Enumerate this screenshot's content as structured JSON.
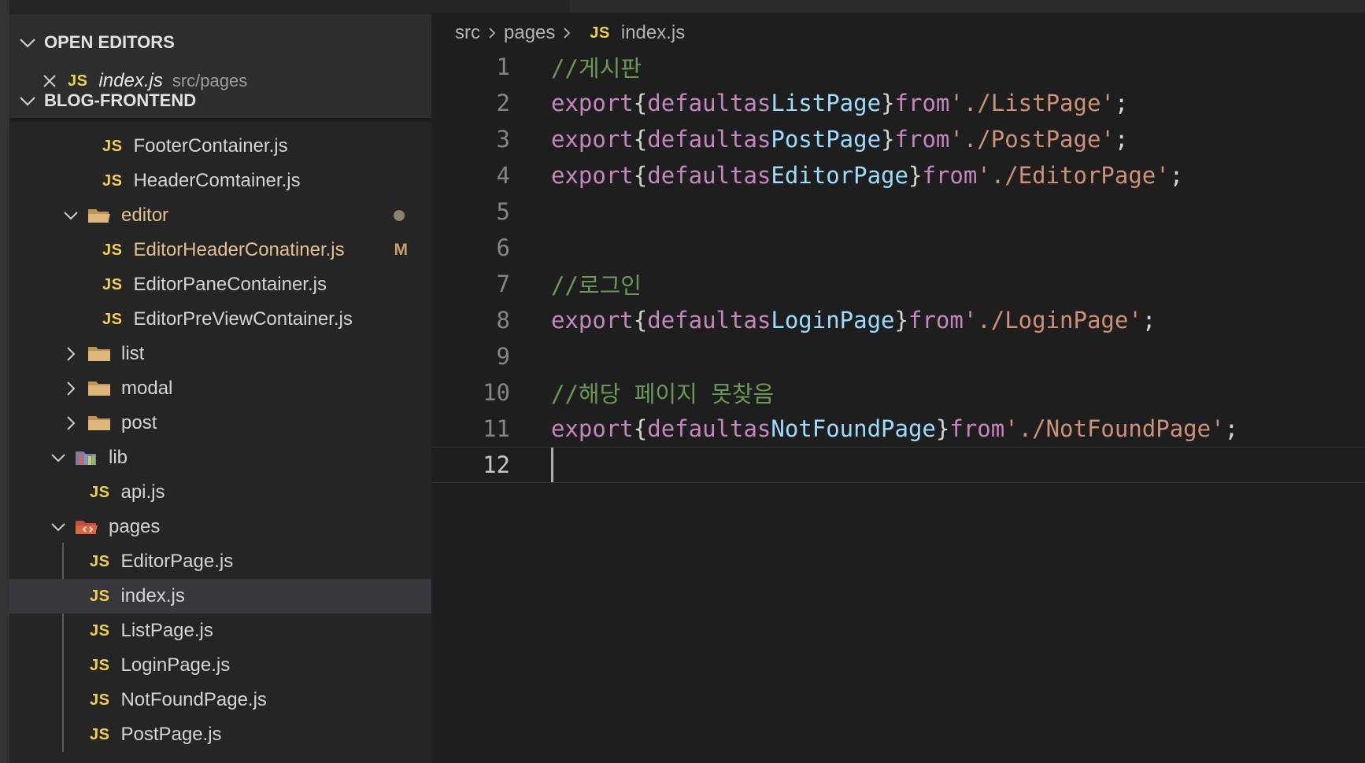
{
  "sidebar": {
    "open_editors": {
      "title": "OPEN EDITORS",
      "item": {
        "badge": "JS",
        "name": "index.js",
        "path": "src/pages"
      }
    },
    "project": {
      "title": "BLOG-FRONTEND"
    },
    "tree": [
      {
        "label": "FooterContainer.js",
        "badge": "JS"
      },
      {
        "label": "HeaderComtainer.js",
        "badge": "JS"
      },
      {
        "label": "editor"
      },
      {
        "label": "EditorHeaderConatiner.js",
        "badge": "JS",
        "status": "M"
      },
      {
        "label": "EditorPaneContainer.js",
        "badge": "JS"
      },
      {
        "label": "EditorPreViewContainer.js",
        "badge": "JS"
      },
      {
        "label": "list"
      },
      {
        "label": "modal"
      },
      {
        "label": "post"
      },
      {
        "label": "lib"
      },
      {
        "label": "api.js",
        "badge": "JS"
      },
      {
        "label": "pages"
      },
      {
        "label": "EditorPage.js",
        "badge": "JS"
      },
      {
        "label": "index.js",
        "badge": "JS"
      },
      {
        "label": "ListPage.js",
        "badge": "JS"
      },
      {
        "label": "LoginPage.js",
        "badge": "JS"
      },
      {
        "label": "NotFoundPage.js",
        "badge": "JS"
      },
      {
        "label": "PostPage.js",
        "badge": "JS"
      }
    ]
  },
  "editor": {
    "breadcrumb": [
      "src",
      "pages",
      "index.js"
    ],
    "breadcrumb_badge": "JS",
    "line_numbers": [
      "1",
      "2",
      "3",
      "4",
      "5",
      "6",
      "7",
      "8",
      "9",
      "10",
      "11",
      "12"
    ],
    "code": {
      "l1_comment": "//게시판",
      "l7_comment": "//로그인",
      "l10_comment": "//해당 페이지 못찾음",
      "kw_export": "export",
      "kw_default": "default",
      "kw_as": "as",
      "kw_from": "from",
      "open_brace": "{",
      "close_brace": "}",
      "semicolon": ";",
      "l2_name": "ListPage",
      "l2_path": "'./ListPage'",
      "l3_name": "PostPage",
      "l3_path": "'./PostPage'",
      "l4_name": "EditorPage",
      "l4_path": "'./EditorPage'",
      "l8_name": "LoginPage",
      "l8_path": "'./LoginPage'",
      "l11_name": "NotFoundPage",
      "l11_path": "'./NotFoundPage'"
    }
  },
  "colors": {
    "comment": "#6a9955",
    "keyword": "#c586c0",
    "identifier": "#9cdcfe",
    "string": "#ce9178",
    "js_badge": "#f1d04e",
    "modified": "#e2c08d"
  }
}
